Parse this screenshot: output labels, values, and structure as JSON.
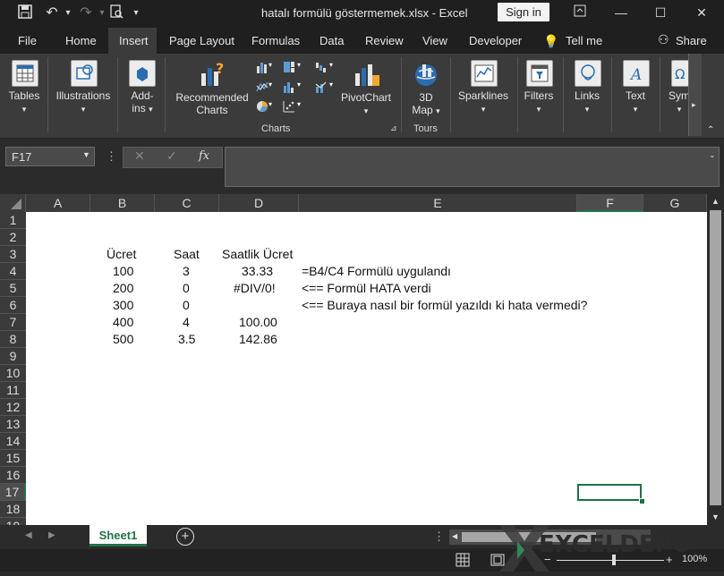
{
  "window": {
    "title": "hatalı formülü göstermemek.xlsx  -  Excel",
    "sign_in": "Sign in"
  },
  "tabs": [
    "File",
    "Home",
    "Insert",
    "Page Layout",
    "Formulas",
    "Data",
    "Review",
    "View",
    "Developer",
    "Tell me",
    "Share"
  ],
  "ribbon": {
    "tables": "Tables",
    "illustrations": "Illustrations",
    "addins1": "Add-",
    "addins2": "ins",
    "recommended1": "Recommended",
    "recommended2": "Charts",
    "pivotchart": "PivotChart",
    "map1": "3D",
    "map2": "Map",
    "sparklines": "Sparklines",
    "filters": "Filters",
    "links": "Links",
    "text": "Text",
    "symbols": "Sym",
    "group_charts": "Charts",
    "group_tours": "Tours"
  },
  "formula_bar": {
    "name_box": "F17",
    "fx": "fx",
    "value": ""
  },
  "columns": [
    "A",
    "B",
    "C",
    "D",
    "E",
    "F",
    "G"
  ],
  "rows": [
    "1",
    "2",
    "3",
    "4",
    "5",
    "6",
    "7",
    "8",
    "9",
    "10",
    "11",
    "12",
    "13",
    "14",
    "15",
    "16",
    "17",
    "18",
    "19"
  ],
  "cells": {
    "B3": "Ücret",
    "C3": "Saat",
    "D3": "Saatlik Ücret",
    "B4": "100",
    "C4": "3",
    "D4": "33.33",
    "E4": "=B4/C4 Formülü uygulandı",
    "B5": "200",
    "C5": "0",
    "D5": "#DIV/0!",
    "E5": "<== Formül HATA verdi",
    "B6": "300",
    "C6": "0",
    "E6": "<== Buraya nasıl bir formül yazıldı ki hata vermedi?",
    "B7": "400",
    "C7": "4",
    "D7": "100.00",
    "B8": "500",
    "C8": "3.5",
    "D8": "142.86"
  },
  "sheet_tab": "Sheet1",
  "status": {
    "zoom": "100%"
  },
  "watermark": "EXCELDEPO",
  "colors": {
    "excel_green": "#217346",
    "selection": "#1e7145"
  }
}
